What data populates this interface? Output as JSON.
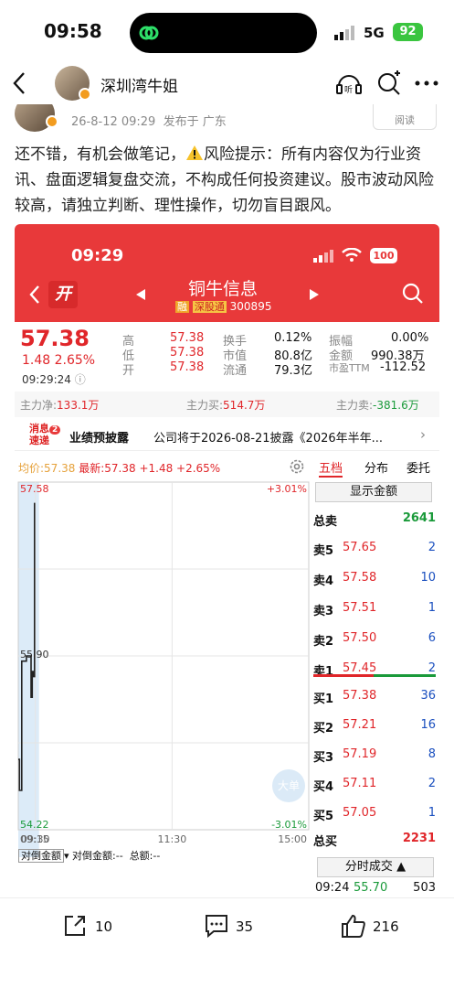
{
  "status_bar": {
    "time": "09:58",
    "network": "5G",
    "battery": "92"
  },
  "header": {
    "author": "深圳湾牛姐"
  },
  "post_meta": {
    "date": "26-8-12 09:29",
    "location": "发布于 广东",
    "read_label": "阅读"
  },
  "post": {
    "text_a": "还不错，有机会做笔记，",
    "text_b": "风险提示：所有内容仅为行业资讯、盘面逻辑复盘交流，不构成任何投资建议。股市波动风险较高，请独立判断、理性操作，切勿盲目跟风。"
  },
  "stock": {
    "time": "09:29",
    "battery": "100",
    "open_label": "开",
    "name": "铜牛信息",
    "tag_rong": "融",
    "tag_sgt": "深股通",
    "code": "300895",
    "price": "57.38",
    "change": "1.48  2.65%",
    "quote_time": "09:29:24",
    "stats": [
      {
        "label": "高",
        "value": "57.38"
      },
      {
        "label": "低",
        "value": "57.38"
      },
      {
        "label": "开",
        "value": "57.38"
      },
      {
        "label": "换手",
        "value": "0.12%"
      },
      {
        "label": "市值",
        "value": "80.8亿"
      },
      {
        "label": "流通",
        "value": "79.3亿"
      },
      {
        "label": "振幅",
        "value": "0.00%"
      },
      {
        "label": "金额",
        "value": "990.38万"
      },
      {
        "label": "市盈TTM",
        "value": "-112.52"
      }
    ],
    "flow": {
      "net_label": "主力净:",
      "net": "133.1万",
      "buy_label": "主力买:",
      "buy": "514.7万",
      "sell_label": "主力卖:",
      "sell": "-381.6万"
    },
    "news": {
      "badge_top": "消息",
      "badge_bottom": "速递",
      "badge_count": "2",
      "title": "业绩预披露",
      "text": "公司将于2026-08-21披露《2026年半年..."
    },
    "chart_header": {
      "avg": "均价:57.38",
      "latest": "最新:57.38 +1.48 +2.65%"
    },
    "tabs": [
      "五档",
      "分布",
      "委托"
    ],
    "show_amount": "显示金额",
    "total_sell_label": "总卖",
    "total_sell": "2641",
    "asks": [
      {
        "label": "卖5",
        "price": "57.65",
        "vol": "2"
      },
      {
        "label": "卖4",
        "price": "57.58",
        "vol": "10"
      },
      {
        "label": "卖3",
        "price": "57.51",
        "vol": "1"
      },
      {
        "label": "卖2",
        "price": "57.50",
        "vol": "6"
      },
      {
        "label": "卖1",
        "price": "57.45",
        "vol": "2"
      }
    ],
    "bids": [
      {
        "label": "买1",
        "price": "57.38",
        "vol": "36"
      },
      {
        "label": "买2",
        "price": "57.21",
        "vol": "16"
      },
      {
        "label": "买3",
        "price": "57.19",
        "vol": "8"
      },
      {
        "label": "买4",
        "price": "57.11",
        "vol": "2"
      },
      {
        "label": "买5",
        "price": "57.05",
        "vol": "1"
      }
    ],
    "total_buy_label": "总买",
    "total_buy": "2231",
    "tick_button": "分时成交",
    "last_tick": {
      "time": "09:24",
      "price": "55.70",
      "vol": "503"
    },
    "big_order": "大单",
    "bottom_labels": {
      "a": "对倒金额",
      "b": "对倒金额:--",
      "c": "总额:--"
    }
  },
  "chart_data": {
    "type": "line",
    "x_ticks": [
      "09:15",
      "09:30",
      "11:30",
      "15:00"
    ],
    "y_top": "57.58",
    "y_mid": "55.90",
    "y_bottom": "54.22",
    "pct_top": "+3.01%",
    "pct_bottom": "-3.01%",
    "ylim": [
      54.22,
      57.58
    ],
    "series": [
      {
        "x": [
          "09:15",
          "09:16",
          "09:17",
          "09:18",
          "09:19",
          "09:20",
          "09:21",
          "09:22",
          "09:23",
          "09:24",
          "09:25",
          "09:26",
          "09:27",
          "09:28",
          "09:29"
        ],
        "values": [
          54.9,
          54.6,
          54.6,
          55.85,
          55.85,
          55.85,
          55.85,
          55.9,
          55.9,
          55.9,
          55.9,
          55.5,
          55.75,
          55.7,
          57.38
        ]
      }
    ]
  },
  "bottom_bar": {
    "share": "10",
    "comment": "35",
    "like": "216"
  }
}
